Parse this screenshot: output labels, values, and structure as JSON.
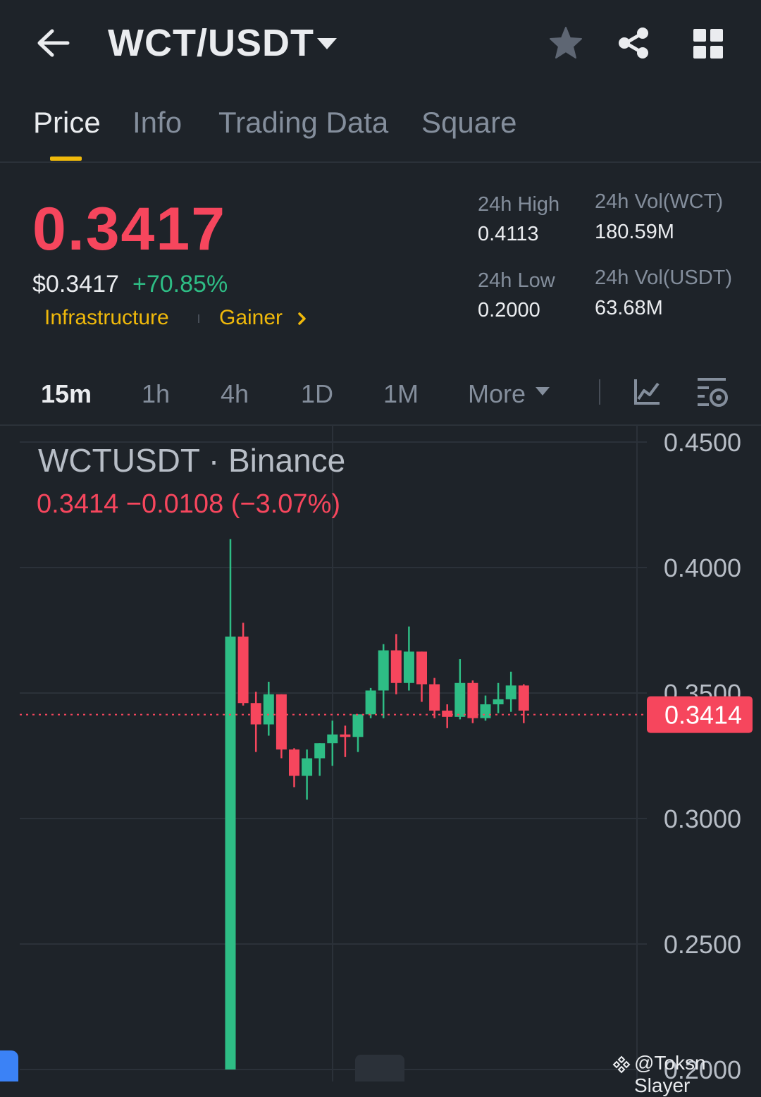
{
  "header": {
    "pair": "WCT/USDT",
    "icons": [
      "back-arrow-icon",
      "dropdown-caret-icon",
      "star-icon",
      "share-icon",
      "grid-menu-icon"
    ]
  },
  "tabs": [
    {
      "label": "Price",
      "active": true
    },
    {
      "label": "Info",
      "active": false
    },
    {
      "label": "Trading Data",
      "active": false
    },
    {
      "label": "Square",
      "active": false
    }
  ],
  "price": {
    "last": "0.3417",
    "usd": "$0.3417",
    "change_pct": "+70.85%",
    "tags": [
      "Infrastructure",
      "Gainer"
    ]
  },
  "stats": {
    "high_label": "24h High",
    "high_value": "0.4113",
    "low_label": "24h Low",
    "low_value": "0.2000",
    "vol_wct_label": "24h Vol(WCT)",
    "vol_wct_value": "180.59M",
    "vol_usdt_label": "24h Vol(USDT)",
    "vol_usdt_value": "63.68M"
  },
  "intervals": [
    {
      "label": "15m",
      "active": true
    },
    {
      "label": "1h",
      "active": false
    },
    {
      "label": "4h",
      "active": false
    },
    {
      "label": "1D",
      "active": false
    },
    {
      "label": "1M",
      "active": false
    },
    {
      "label": "More",
      "active": false
    }
  ],
  "chart": {
    "symbol": "WCTUSDT · Binance",
    "ohlc_text": "0.3414  −0.0108 (−3.07%)",
    "current_price_label": "0.3414",
    "watermark": "@Toksn Slayer"
  },
  "colors": {
    "up": "#2ebd85",
    "down": "#f6465d",
    "accent": "#f0b90b",
    "background": "#1e2329"
  },
  "chart_data": {
    "type": "candlestick",
    "y_ticks": [
      "0.4500",
      "0.4000",
      "0.3500",
      "0.3000",
      "0.2500",
      "0.2000"
    ],
    "ylim": [
      0.2,
      0.45
    ],
    "current_price": 0.3414,
    "candles": [
      {
        "o": 0.2,
        "h": 0.4113,
        "l": 0.2,
        "c": 0.3725
      },
      {
        "o": 0.3725,
        "h": 0.378,
        "l": 0.345,
        "c": 0.346
      },
      {
        "o": 0.346,
        "h": 0.3505,
        "l": 0.3265,
        "c": 0.3375
      },
      {
        "o": 0.3375,
        "h": 0.3545,
        "l": 0.333,
        "c": 0.3495
      },
      {
        "o": 0.3495,
        "h": 0.3495,
        "l": 0.324,
        "c": 0.3275
      },
      {
        "o": 0.3275,
        "h": 0.328,
        "l": 0.3125,
        "c": 0.317
      },
      {
        "o": 0.317,
        "h": 0.3275,
        "l": 0.3075,
        "c": 0.324
      },
      {
        "o": 0.324,
        "h": 0.33,
        "l": 0.317,
        "c": 0.33
      },
      {
        "o": 0.33,
        "h": 0.339,
        "l": 0.321,
        "c": 0.3335
      },
      {
        "o": 0.3335,
        "h": 0.337,
        "l": 0.3245,
        "c": 0.3325
      },
      {
        "o": 0.3325,
        "h": 0.3415,
        "l": 0.3265,
        "c": 0.3415
      },
      {
        "o": 0.3415,
        "h": 0.352,
        "l": 0.34,
        "c": 0.351
      },
      {
        "o": 0.351,
        "h": 0.3695,
        "l": 0.34,
        "c": 0.367
      },
      {
        "o": 0.367,
        "h": 0.3735,
        "l": 0.3495,
        "c": 0.354
      },
      {
        "o": 0.354,
        "h": 0.3765,
        "l": 0.351,
        "c": 0.3665
      },
      {
        "o": 0.3665,
        "h": 0.3665,
        "l": 0.3465,
        "c": 0.3535
      },
      {
        "o": 0.3535,
        "h": 0.356,
        "l": 0.34,
        "c": 0.343
      },
      {
        "o": 0.343,
        "h": 0.3455,
        "l": 0.336,
        "c": 0.3405
      },
      {
        "o": 0.3405,
        "h": 0.3635,
        "l": 0.3395,
        "c": 0.354
      },
      {
        "o": 0.354,
        "h": 0.355,
        "l": 0.338,
        "c": 0.34
      },
      {
        "o": 0.34,
        "h": 0.349,
        "l": 0.339,
        "c": 0.3455
      },
      {
        "o": 0.3455,
        "h": 0.354,
        "l": 0.342,
        "c": 0.3475
      },
      {
        "o": 0.3475,
        "h": 0.3585,
        "l": 0.3425,
        "c": 0.353
      },
      {
        "o": 0.353,
        "h": 0.3535,
        "l": 0.338,
        "c": 0.343
      }
    ]
  }
}
